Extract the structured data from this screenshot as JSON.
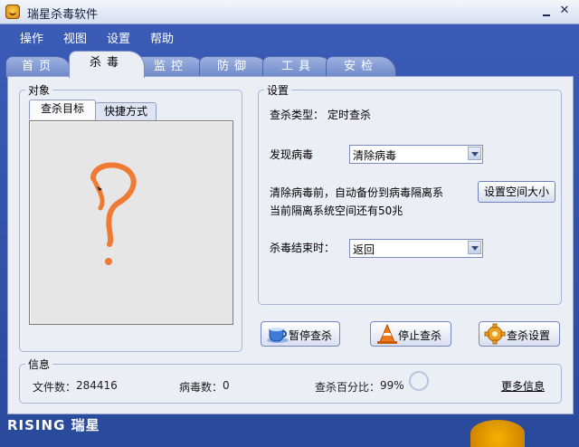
{
  "window": {
    "title": "瑞星杀毒软件"
  },
  "menu": [
    "操作",
    "视图",
    "设置",
    "帮助"
  ],
  "tabs": [
    {
      "label": "首页"
    },
    {
      "label": "杀毒",
      "active": true
    },
    {
      "label": "监控"
    },
    {
      "label": "防御"
    },
    {
      "label": "工具"
    },
    {
      "label": "安检"
    }
  ],
  "object_group": {
    "title": "对象",
    "subtabs": [
      "查杀目标",
      "快捷方式"
    ]
  },
  "settings": {
    "title": "设置",
    "scan_type_label": "查杀类型：",
    "scan_type_value": "定时查杀",
    "found_virus_label": "发现病毒",
    "found_virus_value": "清除病毒",
    "backup_note_line1": "清除病毒前，自动备份到病毒隔离系",
    "backup_note_line2": "当前隔离系统空间还有50兆",
    "set_space_button": "设置空间大小",
    "scan_end_label": "杀毒结束时：",
    "scan_end_value": "返回"
  },
  "actions": {
    "pause": "暂停查杀",
    "stop": "停止查杀",
    "settings": "查杀设置"
  },
  "info": {
    "title": "信息",
    "files_label": "文件数：",
    "files_value": "284416",
    "viruses_label": "病毒数：",
    "viruses_value": "0",
    "percent_label": "查杀百分比：",
    "percent_value": "99%",
    "more_link": "更多信息"
  },
  "brand": {
    "logo": "RISING 瑞星"
  },
  "colors": {
    "window_bg": "#2a4a9c",
    "panel_bg": "#eceef6",
    "doodle": "#ee7a33"
  }
}
